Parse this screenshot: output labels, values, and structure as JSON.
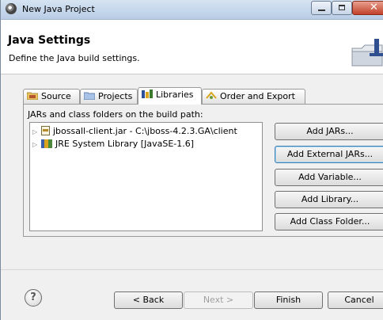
{
  "window": {
    "title": "New Java Project"
  },
  "header": {
    "title": "Java Settings",
    "subtitle": "Define the Java build settings."
  },
  "tabs": [
    {
      "label": "Source",
      "icon": "source-folder-icon",
      "active": false
    },
    {
      "label": "Projects",
      "icon": "projects-icon",
      "active": false
    },
    {
      "label": "Libraries",
      "icon": "libraries-icon",
      "active": true
    },
    {
      "label": "Order and Export",
      "icon": "order-export-icon",
      "active": false
    }
  ],
  "build_path": {
    "label": "JARs and class folders on the build path:",
    "items": [
      {
        "label": "jbossall-client.jar - C:\\jboss-4.2.3.GA\\client",
        "icon": "jar-icon"
      },
      {
        "label": "JRE System Library [JavaSE-1.6]",
        "icon": "library-icon"
      }
    ]
  },
  "actions": {
    "add_jars": "Add JARs...",
    "add_external_jars": "Add External JARs...",
    "add_variable": "Add Variable...",
    "add_library": "Add Library...",
    "add_class_folder": "Add Class Folder..."
  },
  "footer": {
    "back": "< Back",
    "next": "Next >",
    "finish": "Finish",
    "cancel": "Cancel"
  }
}
